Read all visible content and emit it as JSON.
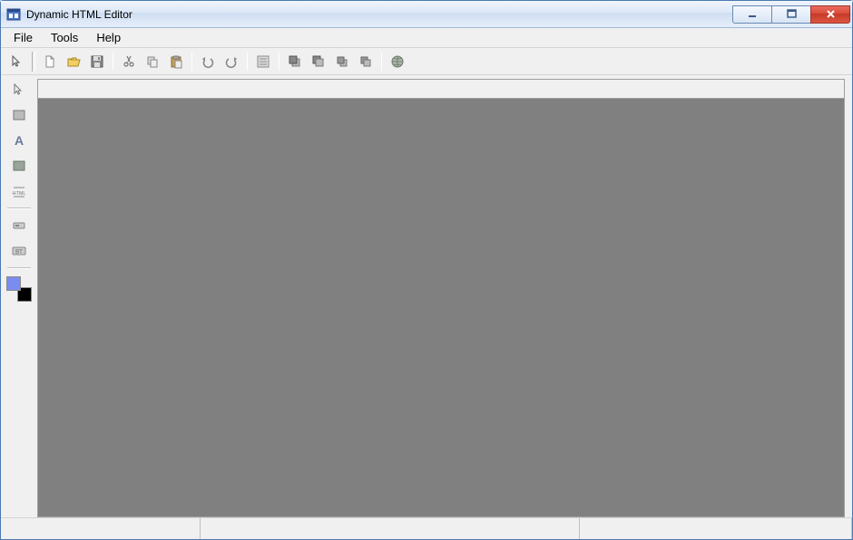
{
  "window": {
    "title": "Dynamic HTML Editor"
  },
  "menu": {
    "file": "File",
    "tools": "Tools",
    "help": "Help"
  },
  "toolbar": {
    "select": "select",
    "new": "new",
    "open": "open",
    "save": "save",
    "cut": "cut",
    "copy": "copy",
    "paste": "paste",
    "undo": "undo",
    "redo": "redo",
    "properties": "properties",
    "bring_front": "bring-to-front",
    "send_back": "send-to-back",
    "bring_forward": "bring-forward",
    "send_backward": "send-backward",
    "web": "web"
  },
  "sidetools": {
    "select": "select",
    "rectangle": "rectangle",
    "text": "text",
    "image": "image",
    "html": "HTML",
    "button": "button",
    "text_button": "BT"
  },
  "colors": {
    "foreground": "#7a8cf0",
    "background": "#000000"
  }
}
